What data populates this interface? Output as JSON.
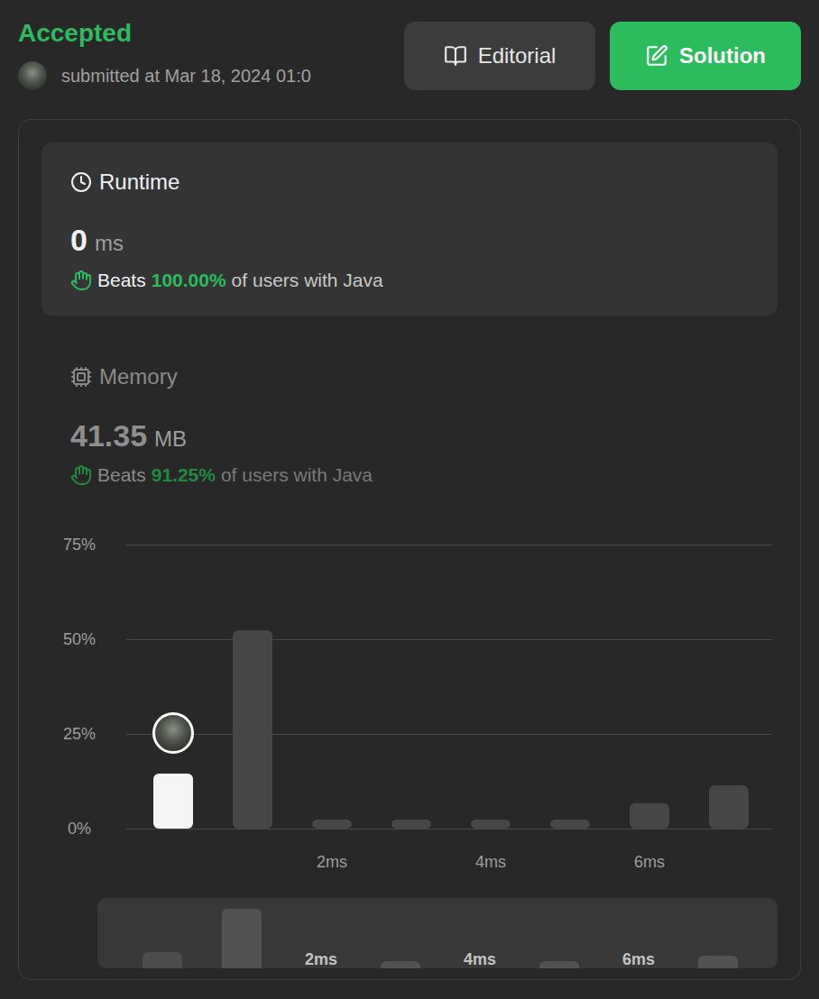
{
  "header": {
    "status": "Accepted",
    "submitted": "submitted at Mar 18, 2024 01:0",
    "buttons": [
      {
        "label": "Editorial",
        "kind": "secondary"
      },
      {
        "label": "Solution",
        "kind": "primary"
      }
    ]
  },
  "runtime": {
    "title": "Runtime",
    "value": "0",
    "unit": "ms",
    "beats_label": "Beats",
    "beats": "100.00%",
    "suffix": "of users with Java",
    "selected": true
  },
  "memory": {
    "title": "Memory",
    "value": "41.35",
    "unit": "MB",
    "beats_label": "Beats",
    "beats": "91.25%",
    "suffix": "of users with Java",
    "selected": false
  },
  "chart": {
    "y_ticks": [
      "75%",
      "50%",
      "25%",
      "0%"
    ],
    "y_max": 75,
    "bars": [
      {
        "value": 14.5,
        "selected": true
      },
      {
        "value": 52.4,
        "selected": false
      },
      {
        "value": 2.4,
        "selected": false
      },
      {
        "value": 2.4,
        "selected": false
      },
      {
        "value": 2.4,
        "selected": false
      },
      {
        "value": 2.4,
        "selected": false
      },
      {
        "value": 6.7,
        "selected": false
      },
      {
        "value": 11.4,
        "selected": false
      }
    ],
    "x_ticks": [
      {
        "label": "2ms",
        "index": 2
      },
      {
        "label": "4ms",
        "index": 4
      },
      {
        "label": "6ms",
        "index": 6
      }
    ]
  },
  "minimap": {
    "x_ticks": [
      {
        "label": "2ms",
        "index": 2
      },
      {
        "label": "4ms",
        "index": 4
      },
      {
        "label": "6ms",
        "index": 6
      }
    ]
  }
}
